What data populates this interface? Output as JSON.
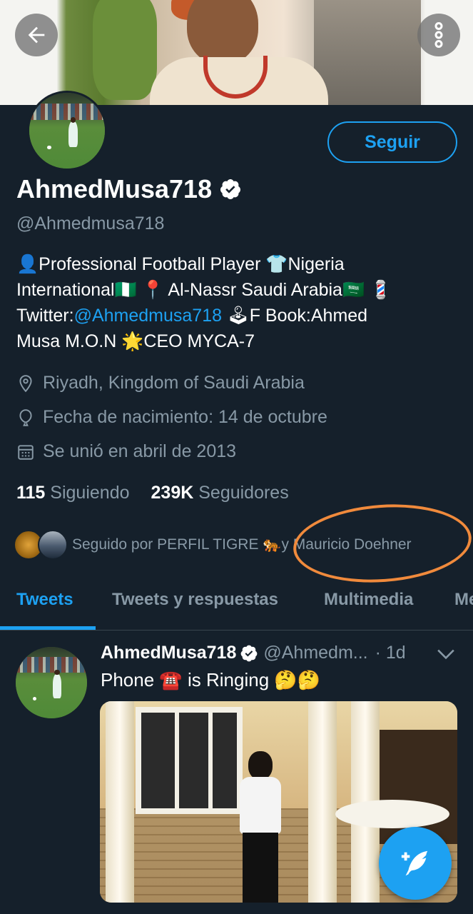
{
  "profile": {
    "display_name": "AhmedMusa718",
    "handle": "@Ahmedmusa718",
    "follow_label": "Seguir",
    "bio": {
      "line1_a": "Professional Football Player ",
      "line1_b": "Nigeria",
      "line2_a": "International",
      "line2_b": " Al-Nassr Saudi Arabia",
      "line3_a": "Twitter:",
      "line3_link": "@Ahmedmusa718",
      "line3_b": "F Book:Ahmed",
      "line4_a": "Musa M.O.N ",
      "line4_b": "CEO MYCA-7"
    },
    "location": "Riyadh, Kingdom of Saudi Arabia",
    "birthday": "Fecha de nacimiento: 14 de octubre",
    "joined": "Se unió en abril de 2013",
    "following_count": "115",
    "following_label": "Siguiendo",
    "followers_count": "239K",
    "followers_label": "Seguidores",
    "followed_by": "Seguido por PERFIL TIGRE",
    "followed_by_and": "y Mauricio Doehner"
  },
  "tabs": [
    "Tweets",
    "Tweets y respuestas",
    "Multimedia",
    "Me"
  ],
  "tweet": {
    "name": "AhmedMusa718",
    "handle": "@Ahmedm...",
    "time": "· 1d",
    "text_a": "Phone ",
    "text_b": " is Ringing "
  },
  "colors": {
    "background": "#15202b",
    "accent": "#1da1f2",
    "muted": "#8899a6",
    "annotation": "#f08a3c"
  },
  "icons": [
    "back-arrow-icon",
    "more-vertical-icon",
    "verified-badge-icon",
    "location-pin-icon",
    "balloon-icon",
    "calendar-icon",
    "chevron-down-icon",
    "compose-tweet-icon"
  ]
}
